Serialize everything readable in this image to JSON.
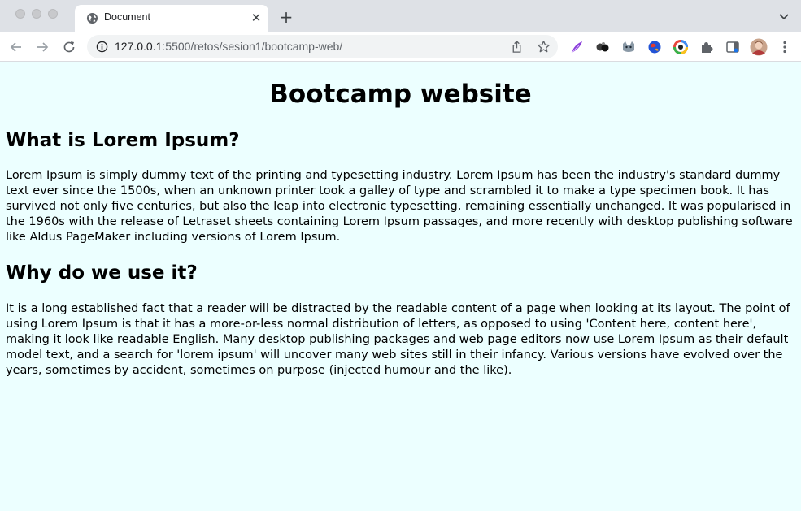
{
  "browser": {
    "tab": {
      "title": "Document"
    },
    "address_bar": {
      "host": "127.0.0.1",
      "path": ":5500/retos/sesion1/bootcamp-web/"
    },
    "icons": {
      "tab_favicon": "globe-icon",
      "close": "close-icon",
      "new_tab": "plus-icon",
      "tab_list": "chevron-down-icon",
      "back": "back-arrow-icon",
      "forward": "forward-arrow-icon",
      "reload": "reload-icon",
      "site_info": "info-icon",
      "share": "share-icon",
      "bookmark": "star-icon",
      "extensions": [
        "feather-extension-icon",
        "dots-extension-icon",
        "cat-extension-icon",
        "globe-extension-icon",
        "color-wheel-extension-icon",
        "puzzle-icon",
        "side-panel-icon",
        "profile-avatar-icon",
        "kebab-menu-icon"
      ]
    },
    "colors": {
      "page_background": "#ecffff",
      "chrome_background": "#dee1e6"
    }
  },
  "page": {
    "title": "Bootcamp website",
    "sections": [
      {
        "heading": "What is Lorem Ipsum?",
        "body": "Lorem Ipsum is simply dummy text of the printing and typesetting industry. Lorem Ipsum has been the industry's standard dummy text ever since the 1500s, when an unknown printer took a galley of type and scrambled it to make a type specimen book. It has survived not only five centuries, but also the leap into electronic typesetting, remaining essentially unchanged. It was popularised in the 1960s with the release of Letraset sheets containing Lorem Ipsum passages, and more recently with desktop publishing software like Aldus PageMaker including versions of Lorem Ipsum."
      },
      {
        "heading": "Why do we use it?",
        "body": "It is a long established fact that a reader will be distracted by the readable content of a page when looking at its layout. The point of using Lorem Ipsum is that it has a more-or-less normal distribution of letters, as opposed to using 'Content here, content here', making it look like readable English. Many desktop publishing packages and web page editors now use Lorem Ipsum as their default model text, and a search for 'lorem ipsum' will uncover many web sites still in their infancy. Various versions have evolved over the years, sometimes by accident, sometimes on purpose (injected humour and the like)."
      }
    ]
  }
}
